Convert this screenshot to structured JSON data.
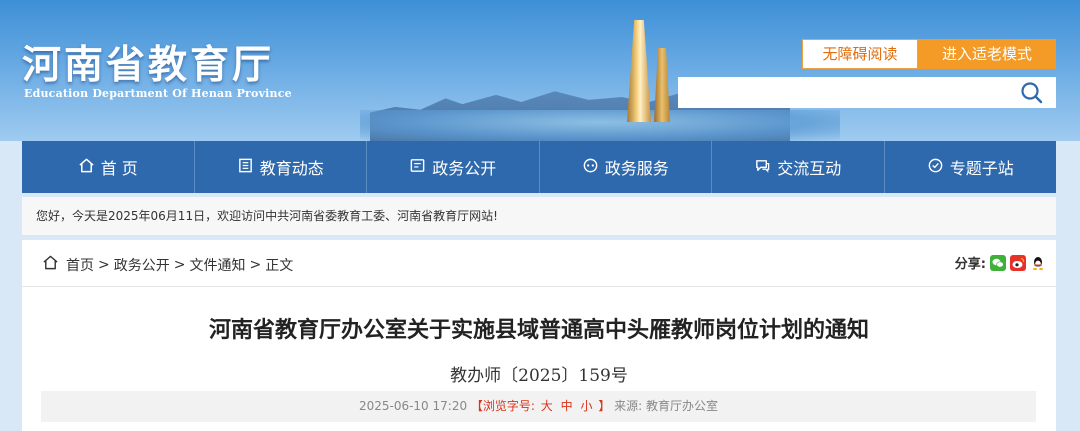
{
  "header": {
    "site_title": "河南省教育厅",
    "site_subtitle": "Education Department Of Henan Province",
    "accessibility_label": "无障碍阅读",
    "elder_mode_label": "进入适老模式",
    "search_placeholder": ""
  },
  "nav": {
    "items": [
      {
        "label": "首 页",
        "icon": "home-icon"
      },
      {
        "label": "教育动态",
        "icon": "newspaper-icon"
      },
      {
        "label": "政务公开",
        "icon": "document-icon"
      },
      {
        "label": "政务服务",
        "icon": "service-icon"
      },
      {
        "label": "交流互动",
        "icon": "chat-icon"
      },
      {
        "label": "专题子站",
        "icon": "topic-icon"
      }
    ]
  },
  "notice": "您好，今天是2025年06月11日，欢迎访问中共河南省委教育工委、河南省教育厅网站!",
  "breadcrumb": {
    "items": [
      "首页",
      "政务公开",
      "文件通知"
    ],
    "current": "正文",
    "separator": ">"
  },
  "share": {
    "label": "分享:",
    "icons": [
      "wechat-icon",
      "weibo-icon",
      "qq-icon"
    ]
  },
  "article": {
    "title": "河南省教育厅办公室关于实施县域普通高中头雁教师岗位计划的通知",
    "doc_number": "教办师〔2025〕159号",
    "date": "2025-06-10 17:20",
    "font_size_label": "【浏览字号:",
    "font_sizes": [
      "大",
      "中",
      "小"
    ],
    "font_size_close": "】",
    "source": "来源: 教育厅办公室"
  },
  "colors": {
    "nav_bg": "#2f69ad",
    "accent_orange": "#f39a27",
    "page_bg": "#d9e8f7"
  }
}
